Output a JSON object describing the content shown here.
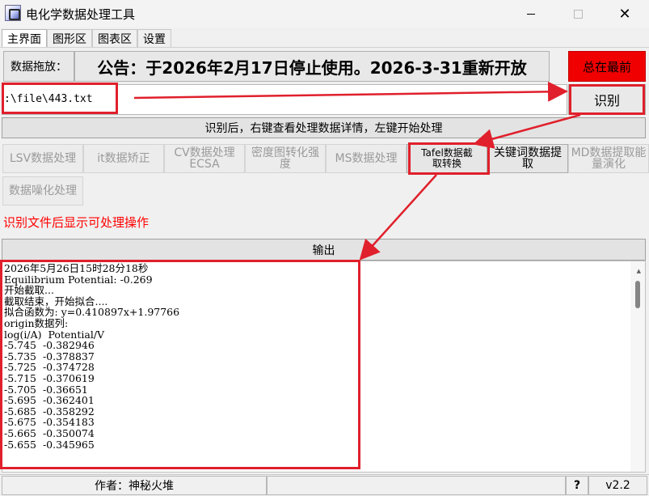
{
  "window": {
    "title": "电化学数据处理工具"
  },
  "tabs": [
    {
      "label": "主界面",
      "active": true
    },
    {
      "label": "图形区"
    },
    {
      "label": "图表区"
    },
    {
      "label": "设置"
    }
  ],
  "drag": {
    "label": "数据拖放：",
    "notice": "公告：于2026年2月17日停止使用。2026-3-31重新开放"
  },
  "ontop_label": "总在最前",
  "path": {
    "value": ":\\file\\443.txt"
  },
  "identify_label": "识别",
  "hint": "识别后，右键查看处理数据详情，左键开始处理",
  "ops": {
    "lsv": "LSV数据处理",
    "it": "it数据矫正",
    "cv_line1": "CV数据处理",
    "cv_line2": "ECSA",
    "density": "密度图转化强度",
    "ms": "MS数据处理",
    "tafel_line1": "Tafel数据截",
    "tafel_line2": "取转换",
    "keyword": "关键词数据提取",
    "md": "MD数据提取能量演化",
    "noise": "数据噪化处理"
  },
  "red_hint": "识别文件后显示可处理操作",
  "output_label": "输出",
  "output_lines": [
    "2026年5月26日15时28分18秒",
    "Equilibrium Potential: -0.269",
    "开始截取...",
    "截取结束，开始拟合....",
    "拟合函数为: y=0.410897x+1.97766",
    "origin数据列:",
    "log(i/A)  Potential/V",
    "-5.745  -0.382946",
    "-5.735  -0.378837",
    "-5.725  -0.374728",
    "-5.715  -0.370619",
    "-5.705  -0.36651",
    "-5.695  -0.362401",
    "-5.685  -0.358292",
    "-5.675  -0.354183",
    "-5.665  -0.350074",
    "-5.655  -0.345965"
  ],
  "status": {
    "author": "作者：神秘火堆",
    "help": "?",
    "version": "v2.2"
  },
  "colors": {
    "annotation": "#e0202c",
    "ontop_bg": "#f00000",
    "hint_red": "#ff0000"
  },
  "icons": [
    "app-icon",
    "minimize-icon",
    "maximize-icon",
    "close-icon",
    "scroll-up-icon"
  ]
}
